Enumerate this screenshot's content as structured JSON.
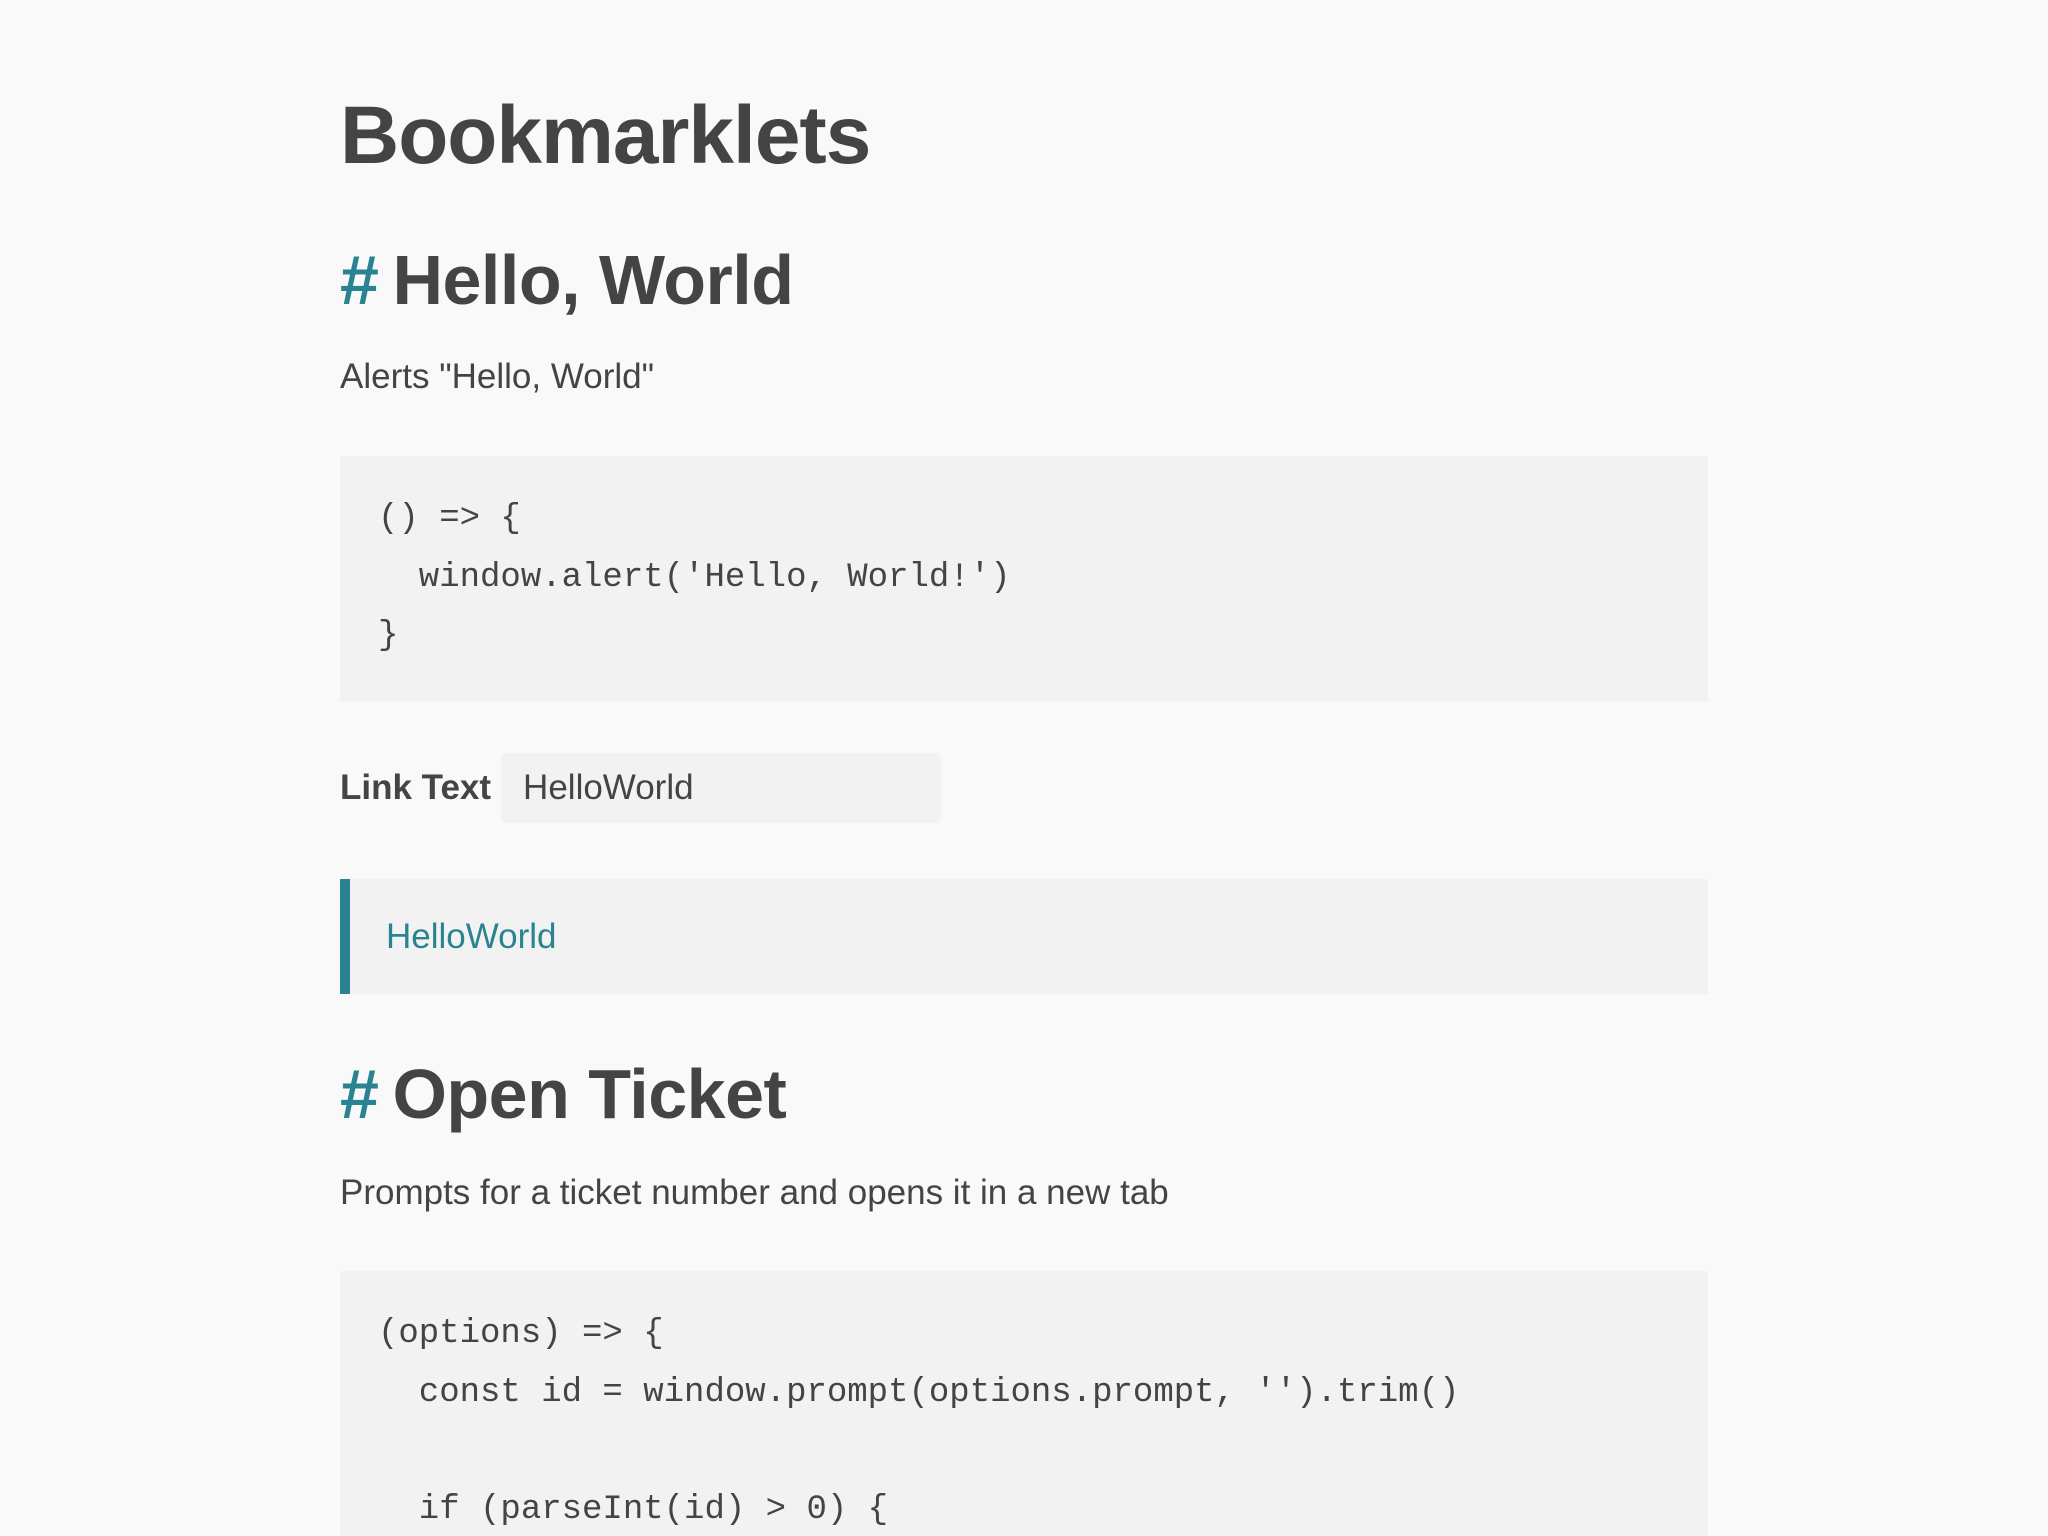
{
  "page_title": "Bookmarklets",
  "heading_marker": "#",
  "sections": [
    {
      "title": "Hello, World",
      "description": "Alerts \"Hello, World\"",
      "code": "() => {\n  window.alert('Hello, World!')\n}",
      "link_text_label": "Link Text",
      "link_text_value": "HelloWorld",
      "bookmarklet_link": "HelloWorld"
    },
    {
      "title": "Open Ticket",
      "description": "Prompts for a ticket number and opens it in a new tab",
      "code": "(options) => {\n  const id = window.prompt(options.prompt, '').trim()\n\n  if (parseInt(id) > 0) {"
    }
  ],
  "colors": {
    "accent": "#2a8390",
    "text": "#444444",
    "page_background": "#f9f9f9",
    "block_background": "#f2f2f2"
  }
}
